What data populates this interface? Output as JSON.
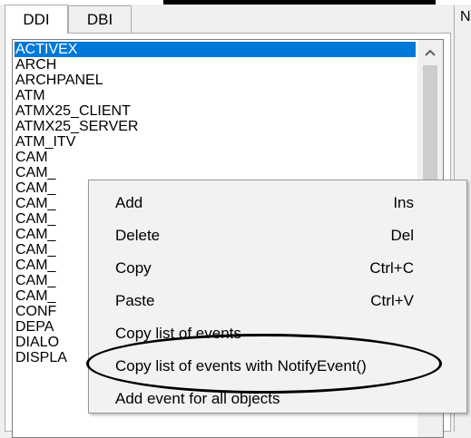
{
  "tabs": [
    {
      "label": "DDI"
    },
    {
      "label": "DBI"
    }
  ],
  "side_panel": {
    "partial_label": "N"
  },
  "object_list": {
    "items": [
      {
        "label": "ACTIVEX",
        "selected": true
      },
      {
        "label": "ARCH"
      },
      {
        "label": "ARCHPANEL"
      },
      {
        "label": "ATM"
      },
      {
        "label": "ATMX25_CLIENT"
      },
      {
        "label": "ATMX25_SERVER"
      },
      {
        "label": "ATM_ITV"
      },
      {
        "label": "CAM"
      },
      {
        "label": "CAM_"
      },
      {
        "label": "CAM_"
      },
      {
        "label": "CAM_"
      },
      {
        "label": "CAM_"
      },
      {
        "label": "CAM_"
      },
      {
        "label": "CAM_"
      },
      {
        "label": "CAM_"
      },
      {
        "label": "CAM_"
      },
      {
        "label": "CAM_"
      },
      {
        "label": "CONF"
      },
      {
        "label": "DEPA"
      },
      {
        "label": "DIALO"
      },
      {
        "label": "DISPLA"
      }
    ],
    "scroll_up_icon": "chevron-up-icon"
  },
  "context_menu": {
    "items": [
      {
        "label": "Add",
        "shortcut": "Ins"
      },
      {
        "label": "Delete",
        "shortcut": "Del"
      },
      {
        "label": "Copy",
        "shortcut": "Ctrl+C"
      },
      {
        "label": "Paste",
        "shortcut": "Ctrl+V"
      },
      {
        "label": "Copy list of events",
        "shortcut": ""
      },
      {
        "label": "Copy list of events with NotifyEvent()",
        "shortcut": "",
        "highlighted": true
      },
      {
        "label": "Add event for all objects",
        "shortcut": ""
      }
    ]
  },
  "colors": {
    "selection": "#0078d7",
    "menu_bg": "#f2f2f2"
  }
}
